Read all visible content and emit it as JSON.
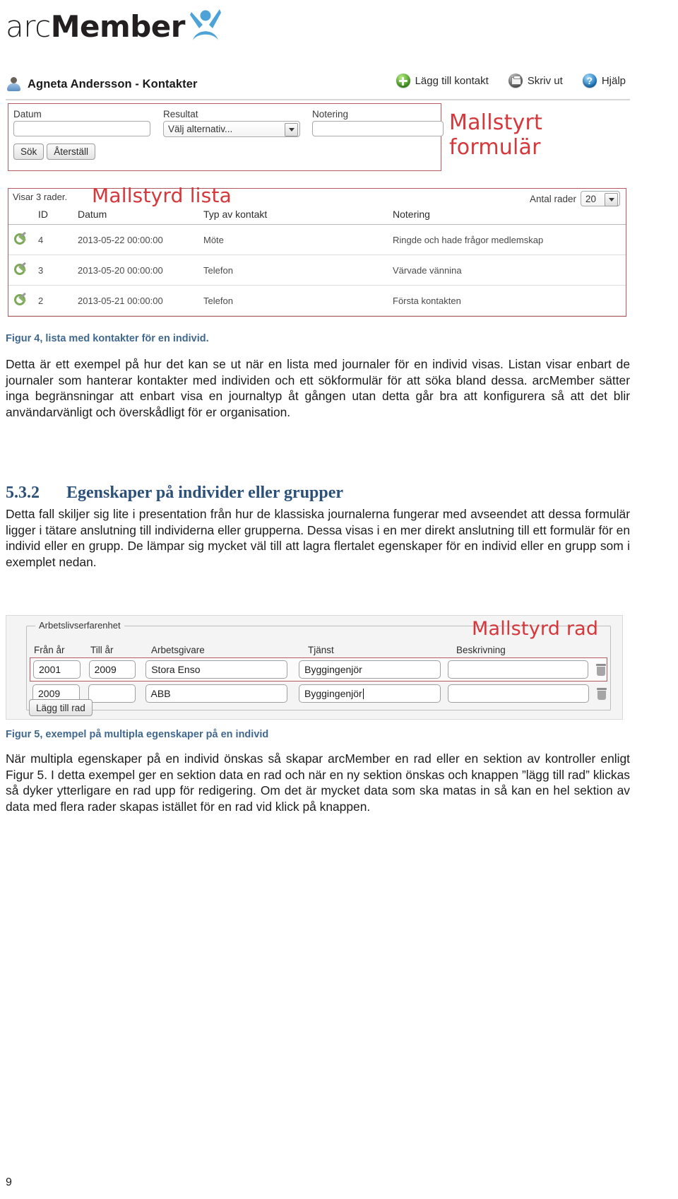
{
  "figure4": {
    "brand": {
      "part1": "arc",
      "part2": "Member",
      "logo_icon": "person-star-icon"
    },
    "appbar": {
      "title": "Agneta Andersson - Kontakter",
      "user_icon": "user-avatar-icon",
      "actions": [
        {
          "label": "Lägg till kontakt",
          "icon": "add-green-orb-icon"
        },
        {
          "label": "Skriv ut",
          "icon": "printer-orb-icon"
        },
        {
          "label": "Hjälp",
          "icon": "help-question-orb-icon"
        }
      ]
    },
    "search_form": {
      "date_label": "Datum",
      "date_value": "",
      "result_label": "Resultat",
      "result_value": "Välj alternativ...",
      "note_label": "Notering",
      "note_value": "",
      "search_button": "Sök",
      "reset_button": "Återställ"
    },
    "annotation_form": "Mallstyrt formulär",
    "annotation_list": "Mallstyrd lista",
    "list": {
      "showing": "Visar 3 rader.",
      "rowcount_label": "Antal rader",
      "rowcount_value": "20",
      "columns": [
        "",
        "ID",
        "Datum",
        "Typ av kontakt",
        "Notering"
      ],
      "rows": [
        {
          "icon": "edit-gear-icon",
          "id": "4",
          "date": "2013-05-22 00:00:00",
          "type": "Möte",
          "note": "Ringde och hade frågor medlemskap"
        },
        {
          "icon": "edit-gear-icon",
          "id": "3",
          "date": "2013-05-20 00:00:00",
          "type": "Telefon",
          "note": "Värvade vännina"
        },
        {
          "icon": "edit-gear-icon",
          "id": "2",
          "date": "2013-05-21 00:00:00",
          "type": "Telefon",
          "note": "Första kontakten"
        }
      ]
    }
  },
  "document": {
    "figure4_caption": "Figur 4, lista med kontakter för en individ.",
    "paragraph1": "Detta är ett exempel på hur det kan se ut när en lista med journaler för en individ visas. Listan visar enbart de journaler som hanterar kontakter med individen och ett sökformulär för att söka bland dessa. arcMember sätter inga begränsningar att enbart visa en journaltyp åt gången utan detta går bra att konfigurera så att det blir användarvänligt och överskådligt för er organisation.",
    "section_number": "5.3.2",
    "section_title": "Egenskaper på individer eller grupper",
    "paragraph2": "Detta fall skiljer sig lite i presentation från hur de klassiska journalerna fungerar med avseendet att dessa formulär ligger i tätare anslutning till individerna eller grupperna. Dessa visas i en mer direkt anslutning till ett formulär för en individ eller en grupp. De lämpar sig mycket väl till att lagra flertalet egenskaper för en individ eller en grupp som i exemplet nedan.",
    "figure5_caption": "Figur 5, exempel på multipla egenskaper på en individ",
    "paragraph3": "När multipla egenskaper på en individ önskas så skapar arcMember en rad eller en sektion av kontroller enligt Figur 5. I detta exempel ger en sektion data en rad och när en ny sektion önskas och knappen ”lägg till rad” klickas så dyker ytterligare en rad upp för redigering. Om det är mycket data som ska matas in så kan en hel sektion av data med flera rader skapas istället för en rad vid klick på knappen.",
    "page_number": "9"
  },
  "figure5": {
    "legend": "Arbetslivserfarenhet",
    "annotation": "Mallstyrd rad",
    "columns": [
      "Från år",
      "Till år",
      "Arbetsgivare",
      "Tjänst",
      "Beskrivning"
    ],
    "rows": [
      {
        "from_year": "2001",
        "to_year": "2009",
        "employer": "Stora Enso",
        "position": "Byggingenjör",
        "description": "",
        "delete_icon": "trash-icon",
        "selected": true
      },
      {
        "from_year": "2009",
        "to_year": "",
        "employer": "ABB",
        "position": "Byggingenjör",
        "description": "",
        "delete_icon": "trash-icon",
        "selected": false
      }
    ],
    "add_row_button": "Lägg till rad"
  },
  "colors": {
    "annotation_red": "#d6373b",
    "caption_blue": "#41688f",
    "heading_blue": "#2b5079",
    "panel_border_red": "#b65c61"
  }
}
